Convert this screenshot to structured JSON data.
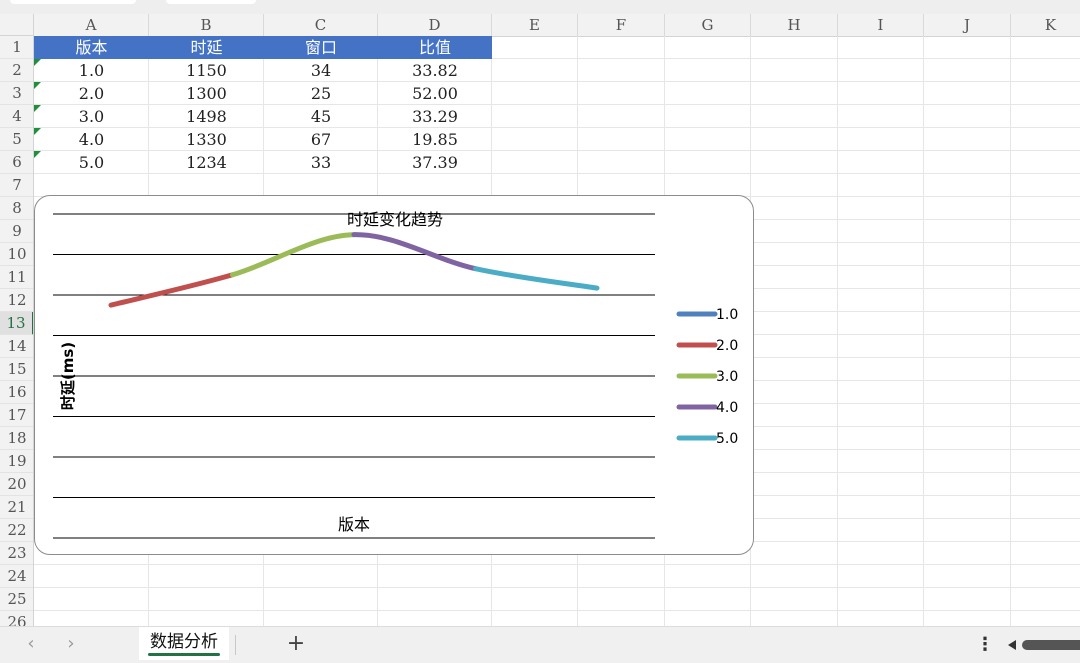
{
  "columns": [
    "A",
    "B",
    "C",
    "D",
    "E",
    "F",
    "G",
    "H",
    "I",
    "J",
    "K"
  ],
  "rows": [
    "1",
    "2",
    "3",
    "4",
    "5",
    "6",
    "7",
    "8",
    "9",
    "10",
    "11",
    "12",
    "13",
    "14",
    "15",
    "16",
    "17",
    "18",
    "19",
    "20",
    "21",
    "22",
    "23",
    "24",
    "25",
    "26"
  ],
  "selected_row": "13",
  "table": {
    "headers": [
      "版本",
      "时延",
      "窗口",
      "比值"
    ],
    "rows": [
      [
        "1.0",
        "1150",
        "34",
        "33.82"
      ],
      [
        "2.0",
        "1300",
        "25",
        "52.00"
      ],
      [
        "3.0",
        "1498",
        "45",
        "33.29"
      ],
      [
        "4.0",
        "1330",
        "67",
        "19.85"
      ],
      [
        "5.0",
        "1234",
        "33",
        "37.39"
      ]
    ],
    "header_color": "#4472c4"
  },
  "chart_data": {
    "type": "line",
    "title": "时延变化趋势",
    "xlabel": "版本",
    "ylabel": "时延(ms)",
    "categories": [
      "1.0",
      "2.0",
      "3.0",
      "4.0",
      "5.0"
    ],
    "values": [
      1150,
      1300,
      1498,
      1330,
      1234
    ],
    "series": [
      {
        "name": "1.0",
        "color": "#4e81bd"
      },
      {
        "name": "2.0",
        "color": "#c0504d"
      },
      {
        "name": "3.0",
        "color": "#9bbb59"
      },
      {
        "name": "4.0",
        "color": "#8064a2"
      },
      {
        "name": "5.0",
        "color": "#4bacc6"
      }
    ],
    "ylim": [
      0,
      1600
    ],
    "gridlines": 9,
    "grid": true,
    "legend": "right",
    "smooth": true
  },
  "sheet_tab": "数据分析",
  "add_sheet": "+",
  "nav": {
    "prev": "‹",
    "next": "›"
  },
  "more_icon": "⋮",
  "icons": {
    "prev": "chevron-left-icon",
    "next": "chevron-right-icon",
    "add": "plus-icon",
    "more": "kebab-icon"
  }
}
